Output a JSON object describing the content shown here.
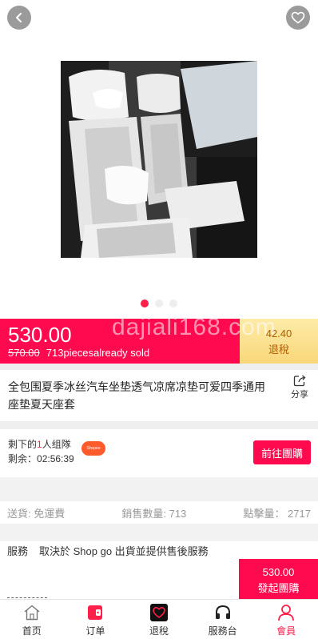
{
  "product": {
    "watermark": "dajiali168.com",
    "title": "全包围夏季冰丝汽车坐垫透气凉席凉垫可爱四季通用座垫夏天座套",
    "share_label": "分享",
    "carousel_total": 3,
    "carousel_active": 1
  },
  "price": {
    "current": "530.00",
    "original": "570.00",
    "sold": "713piecesalready sold",
    "tax_amount": "42.40",
    "tax_label": "退稅"
  },
  "group": {
    "remaining_prefix": "剩下的",
    "remaining_count": "1",
    "remaining_suffix": "人组隊",
    "countdown_label": "剩余：",
    "countdown": "02:56:39",
    "shop_tag": "Shopee",
    "join_button": "前往團購"
  },
  "stats": {
    "shipping": "送貨: 免運費",
    "sales": "銷售數量: 713",
    "clicks": "點擊量： 2717"
  },
  "service": {
    "label": "服務",
    "text": "取決於 Shop go 出貨並提供售後服務"
  },
  "buy": {
    "price": "530.00",
    "label": "發起團購"
  },
  "tabbar": [
    {
      "label": "首页",
      "icon": "home-icon"
    },
    {
      "label": "订单",
      "icon": "order-icon"
    },
    {
      "label": "退稅",
      "icon": "tax-refund-icon"
    },
    {
      "label": "服務台",
      "icon": "headset-icon"
    },
    {
      "label": "會員",
      "icon": "member-icon"
    }
  ],
  "colors": {
    "accent": "#ff0a4e",
    "tax_box": "#f9d77a",
    "tax_text": "#b15b00",
    "shop_tag": "#ff5a2a"
  }
}
